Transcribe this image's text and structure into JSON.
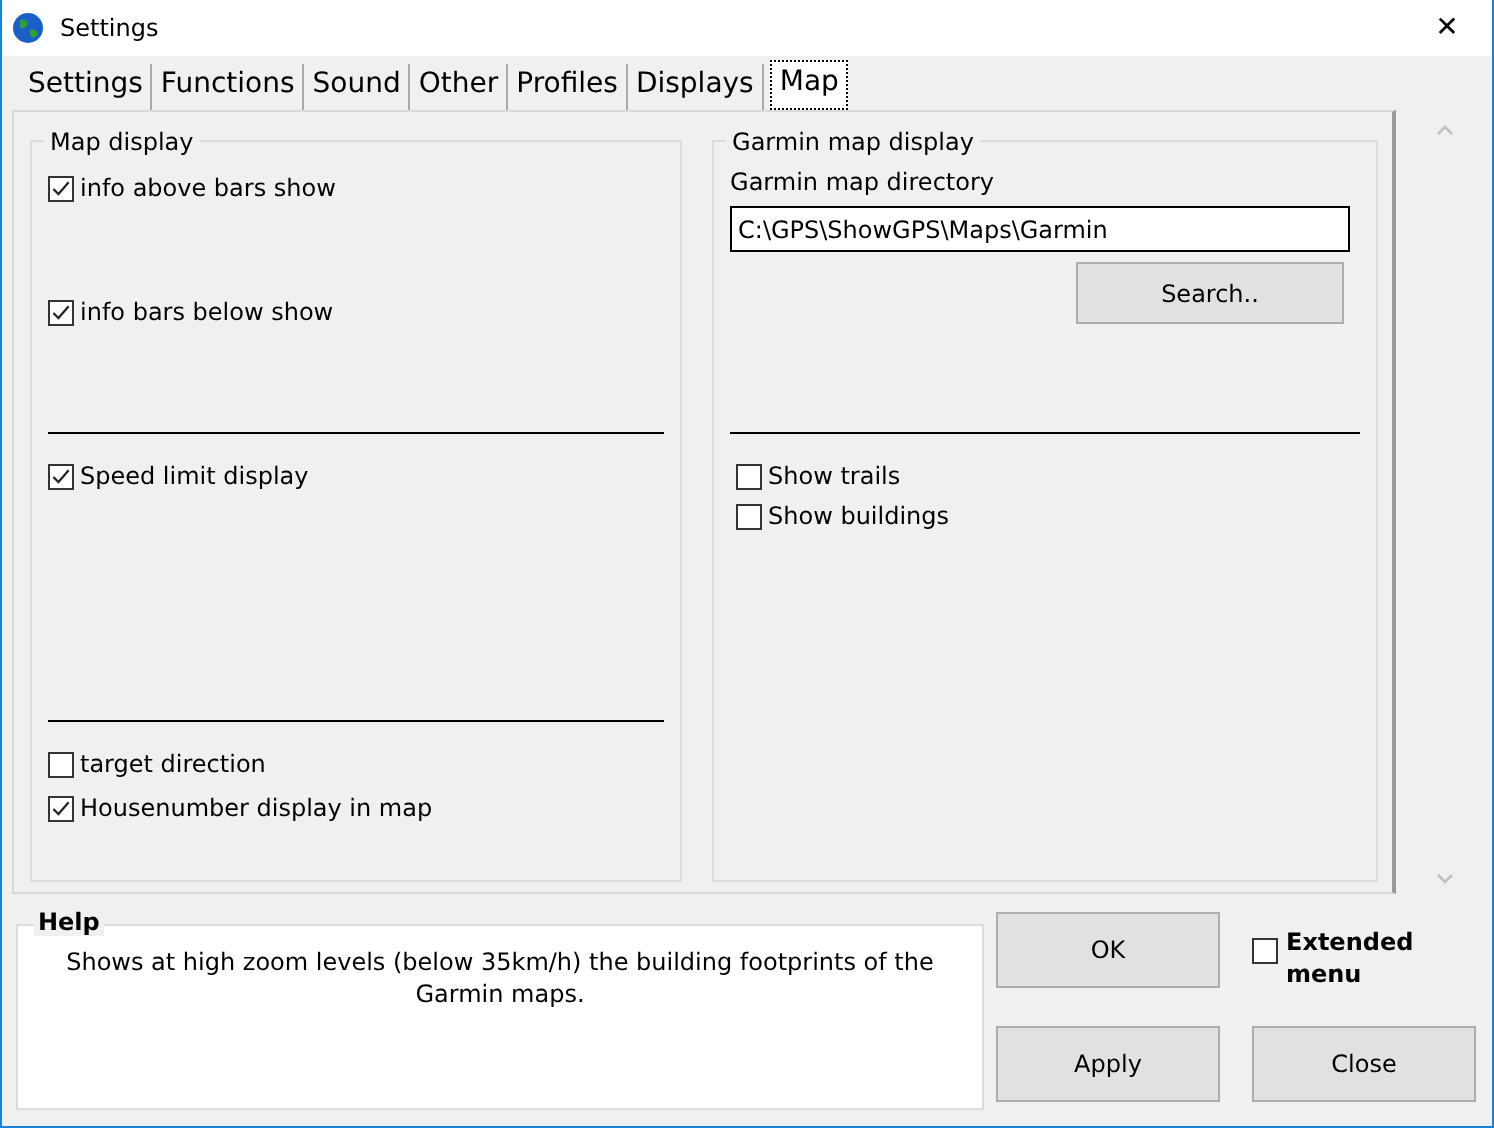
{
  "window": {
    "title": "Settings",
    "close": "✕"
  },
  "tabs": [
    {
      "label": "Settings",
      "selected": false
    },
    {
      "label": "Functions",
      "selected": false
    },
    {
      "label": "Sound",
      "selected": false
    },
    {
      "label": "Other",
      "selected": false
    },
    {
      "label": "Profiles",
      "selected": false
    },
    {
      "label": "Displays",
      "selected": false
    },
    {
      "label": "Map",
      "selected": true
    }
  ],
  "map_display": {
    "title": "Map display",
    "sections": [
      [
        {
          "label": "info above bars show",
          "checked": true
        },
        {
          "label": "info bars below show",
          "checked": true
        }
      ],
      [
        {
          "label": "Speed limit display",
          "checked": true
        }
      ],
      [
        {
          "label": "target direction",
          "checked": false
        },
        {
          "label": "Housenumber display in map",
          "checked": true
        }
      ]
    ]
  },
  "garmin_map_display": {
    "title": "Garmin map display",
    "directory_label": "Garmin map directory",
    "directory_value": "C:\\GPS\\ShowGPS\\Maps\\Garmin",
    "search_button": "Search..",
    "options": [
      {
        "label": "Show trails",
        "checked": false
      },
      {
        "label": "Show buildings",
        "checked": false
      }
    ]
  },
  "help": {
    "title": "Help",
    "text": "Shows at high zoom levels (below 35km/h) the building footprints of the Garmin maps."
  },
  "extended_menu": {
    "label": "Extended menu",
    "checked": false
  },
  "buttons": {
    "ok": "OK",
    "apply": "Apply",
    "close": "Close"
  }
}
